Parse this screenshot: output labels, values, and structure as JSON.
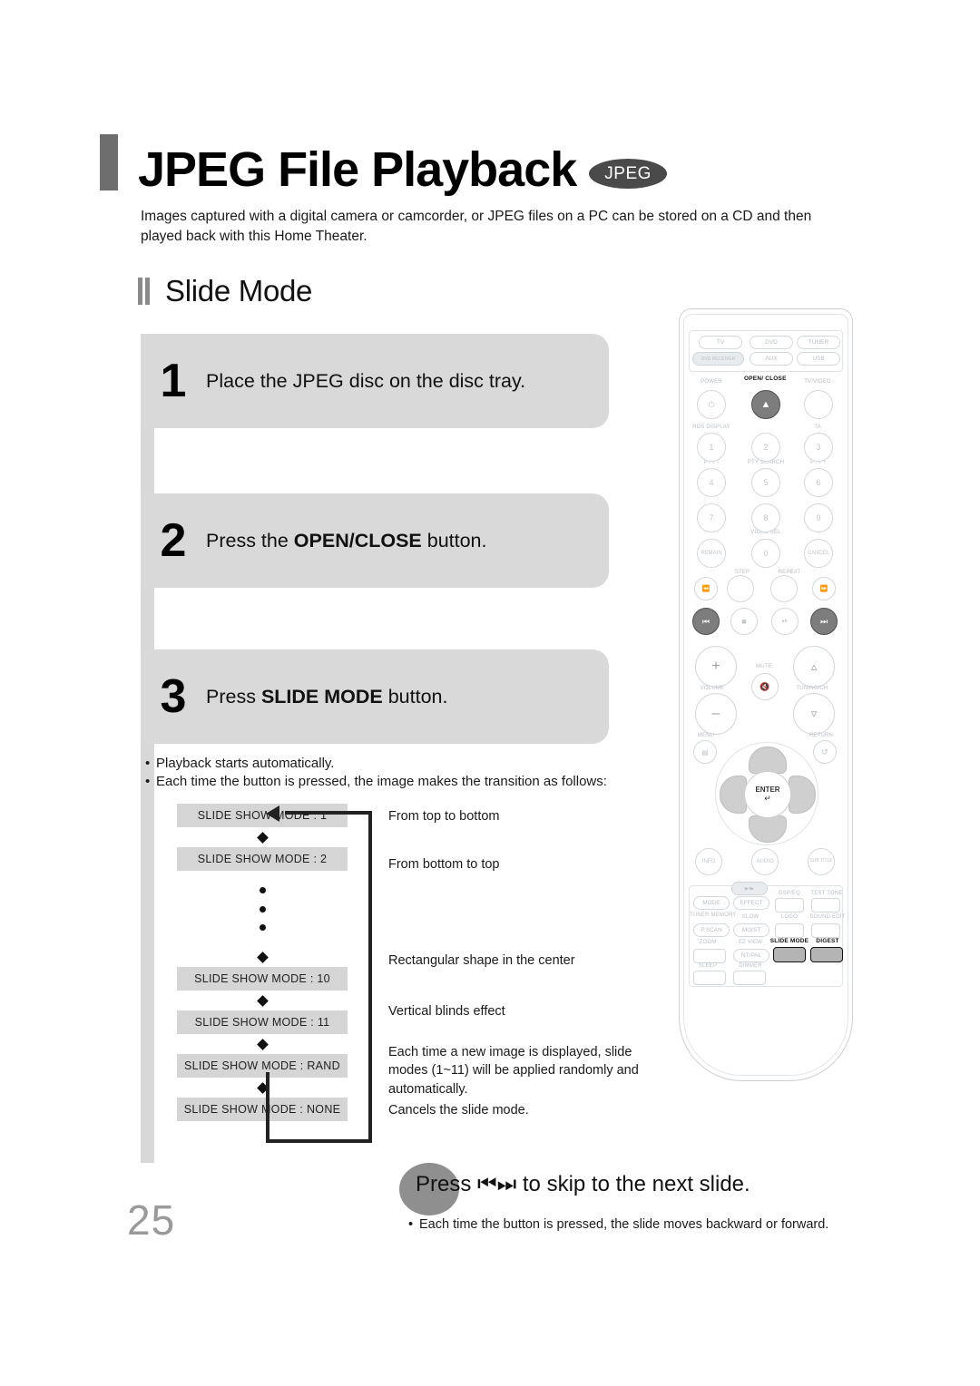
{
  "title": {
    "heading": "JPEG File Playback",
    "badge": "JPEG",
    "intro": "Images captured with a digital camera or camcorder, or JPEG files on a PC can be stored on a CD and then played back with this Home Theater."
  },
  "section": {
    "title": "Slide Mode"
  },
  "steps": [
    {
      "num": "1",
      "text_plain": "Place the JPEG disc on the disc tray.",
      "pre": "Place the JPEG disc on the disc tray.",
      "bold": "",
      "post": ""
    },
    {
      "num": "2",
      "text_plain": "Press the OPEN/CLOSE button.",
      "pre": "Press the ",
      "bold": "OPEN/CLOSE",
      "post": " button."
    },
    {
      "num": "3",
      "text_plain": "Press SLIDE MODE button.",
      "pre": "Press ",
      "bold": "SLIDE MODE",
      "post": " button."
    }
  ],
  "bullets": [
    "Playback starts automatically.",
    "Each time the button is pressed, the image makes the transition as follows:"
  ],
  "flow": {
    "items": [
      {
        "label": "SLIDE SHOW MODE : 1",
        "desc": "From top to bottom"
      },
      {
        "label": "SLIDE SHOW MODE : 2",
        "desc": "From bottom to top"
      },
      {
        "label": "SLIDE SHOW MODE : 10",
        "desc": "Rectangular shape in the center"
      },
      {
        "label": "SLIDE SHOW MODE : 11",
        "desc": "Vertical blinds effect"
      },
      {
        "label": "SLIDE SHOW MODE : RAND",
        "desc": "Each time a new image is displayed, slide modes (1~11) will be applied randomly and automatically."
      },
      {
        "label": "SLIDE SHOW MODE : NONE",
        "desc": "Cancels the slide mode."
      }
    ]
  },
  "callout": {
    "pre": "Press ",
    "icons": "⏮⏭",
    "post": " to skip to the next slide.",
    "note": "Each time the button is pressed, the slide moves backward or forward."
  },
  "page_number": "25",
  "remote": {
    "sources": [
      "TV",
      "DVD",
      "TUNER",
      "DVD RECEIVER",
      "AUX",
      "USB"
    ],
    "power_row": [
      "POWER",
      "OPEN/ CLOSE",
      "TV/VIDEO"
    ],
    "keypad_labels": [
      "RDS DISPLAY",
      "TA",
      "PTY -",
      "PTY SEARCH",
      "PTY +",
      "VIDEO SEL"
    ],
    "keypad": [
      "1",
      "2",
      "3",
      "4",
      "5",
      "6",
      "7",
      "8",
      "9",
      "REMAIN",
      "0",
      "CANCEL"
    ],
    "transport_labels": [
      "STEP",
      "REPEAT"
    ],
    "volume_labels": [
      "VOLUME",
      "MUTE",
      "TUNING/CH",
      "MENU",
      "RETURN"
    ],
    "enter": "ENTER",
    "media_row": [
      "INFO",
      "AUDIO",
      "SUB TITLE"
    ],
    "function_labels": [
      "MODE",
      "EFFECT",
      "DSP/EQ",
      "TEST TONE",
      "TUNER MEMORY",
      "SLOW",
      "LOGO",
      "SOUND EDIT",
      "P.SCAN",
      "MO/ST",
      "ZOOM",
      "EZ VIEW",
      "SLIDE MODE",
      "DIGEST",
      "NT/PAL",
      "SLEEP",
      "DIMMER"
    ],
    "highlighted": [
      "OPEN/CLOSE",
      "SKIP BACK",
      "SKIP FORWARD",
      "SLIDE MODE",
      "DIGEST"
    ]
  },
  "colors": {
    "accent_gray": "#d9d9d9",
    "badge": "#4a4a4a",
    "spine": "#d8d8d8"
  }
}
